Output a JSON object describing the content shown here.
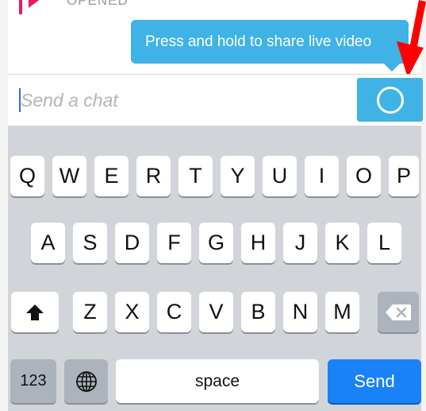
{
  "message": {
    "status": "OPENED"
  },
  "tooltip": {
    "text": "Press and hold to share live video"
  },
  "composer": {
    "placeholder": "Send a chat",
    "live_button_icon": "circle-icon"
  },
  "keyboard": {
    "row1": [
      "Q",
      "W",
      "E",
      "R",
      "T",
      "Y",
      "U",
      "I",
      "O",
      "P"
    ],
    "row2": [
      "A",
      "S",
      "D",
      "F",
      "G",
      "H",
      "J",
      "K",
      "L"
    ],
    "row3": [
      "Z",
      "X",
      "C",
      "V",
      "B",
      "N",
      "M"
    ],
    "shift_icon": "shift-arrow-icon",
    "backspace_icon": "backspace-icon",
    "numbers_label": "123",
    "globe_icon": "globe-icon",
    "space_label": "space",
    "send_label": "Send"
  },
  "colors": {
    "accent_blue": "#3fb3e6",
    "send_blue": "#1a82f7",
    "annotation_red": "#ff0000",
    "marker_pink": "#e8195c"
  }
}
